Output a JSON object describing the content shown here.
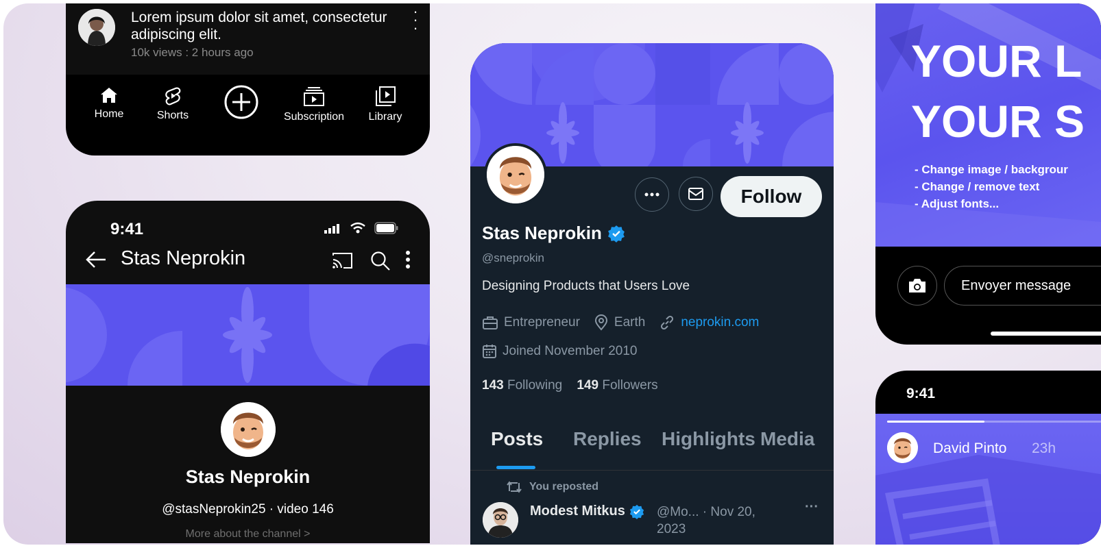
{
  "youtube_bottom": {
    "video_title": "Lorem ipsum dolor sit amet, consectetur adipiscing elit.",
    "video_meta": "10k views : 2 hours ago",
    "nav": [
      {
        "label": "Home",
        "icon": "home-icon"
      },
      {
        "label": "Shorts",
        "icon": "shorts-icon"
      },
      {
        "label": "",
        "icon": "create-plus-icon"
      },
      {
        "label": "Subscription",
        "icon": "subscription-icon"
      },
      {
        "label": "Library",
        "icon": "library-icon"
      }
    ]
  },
  "youtube_channel": {
    "time": "9:41",
    "title": "Stas Neprokin",
    "channel_name": "Stas Neprokin",
    "handle_line": "@stasNeprokin25  · video 146",
    "more_text": "More about the channel  >"
  },
  "twitter": {
    "follow_label": "Follow",
    "name": "Stas Neprokin",
    "handle": "@sneprokin",
    "bio": "Designing Products that Users Love",
    "occupation": "Entrepreneur",
    "location": "Earth",
    "website": "neprokin.com",
    "joined": "Joined November 2010",
    "following_count": "143",
    "following_label": "Following",
    "followers_count": "149",
    "followers_label": "Followers",
    "tabs": [
      "Posts",
      "Replies",
      "Highlights",
      "Media"
    ],
    "repost_label": "You reposted",
    "post_author": "Modest Mitkus",
    "post_meta": "@Mo... · Nov 20, 2023",
    "colors": {
      "accent": "#1d9bf0",
      "background": "#15202b",
      "banner": "#5b54ee"
    }
  },
  "story": {
    "headline_1": "YOUR L",
    "headline_2": "YOUR S",
    "bullets": [
      "- Change image / backgrour",
      "- Change / remove text",
      "- Adjust fonts..."
    ],
    "message_placeholder": "Envoyer message"
  },
  "story2": {
    "time": "9:41",
    "user": "David Pinto",
    "age": "23h",
    "progress": 0.43
  }
}
